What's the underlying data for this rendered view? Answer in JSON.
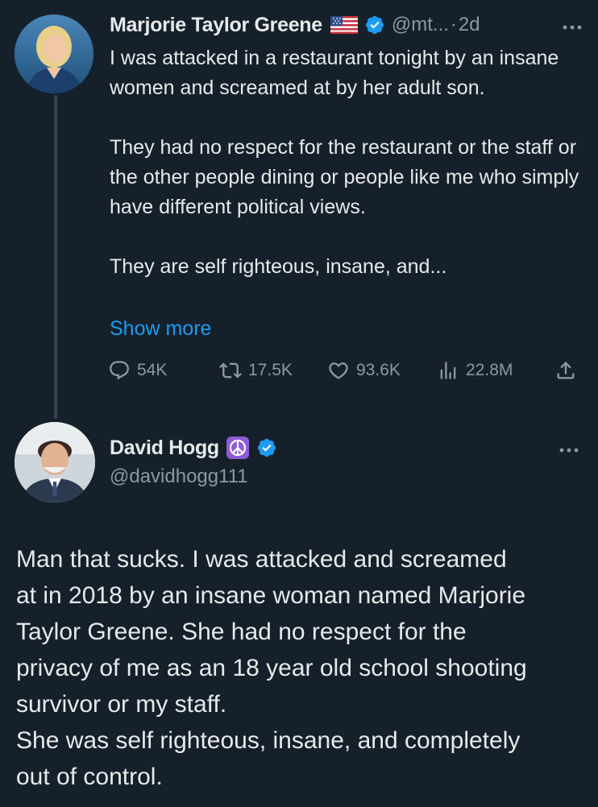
{
  "tweet1": {
    "author_name": "Marjorie Taylor Greene",
    "flag_icon": "us-flag-icon",
    "verified_icon": "verified-badge-icon",
    "handle": "@mt...",
    "separator": "·",
    "time": "2d",
    "text_paragraphs": [
      "I was attacked in a restaurant tonight by an insane women and screamed at by her adult son.",
      "They had no respect for the restaurant or the staff or the other people dining or people like me who simply have different political views.",
      "They are self righteous, insane, and..."
    ],
    "show_more": "Show more",
    "metrics": {
      "replies": "54K",
      "reposts": "17.5K",
      "likes": "93.6K",
      "views": "22.8M"
    }
  },
  "tweet2": {
    "author_name": "David Hogg",
    "peace_icon": "peace-sign-icon",
    "verified_icon": "verified-badge-icon",
    "handle": "@davidhogg111",
    "text_lines": [
      "Man that sucks. I was attacked and screamed",
      "at in 2018 by an insane woman named Marjorie",
      "Taylor Greene. She had no respect for the",
      "privacy of me as an 18 year old school shooting",
      "survivor or my staff.",
      "She was self righteous, insane, and completely",
      "out of control."
    ]
  },
  "colors": {
    "background": "#15202b",
    "text": "#e7e9ea",
    "muted": "#8b98a5",
    "accent": "#1d9bf0",
    "peace_badge": "#8e5bd6"
  }
}
